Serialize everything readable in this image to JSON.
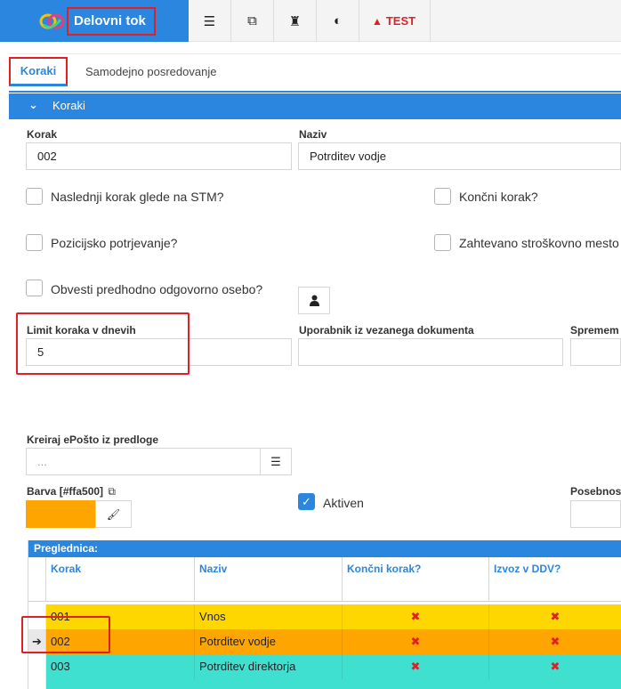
{
  "app": {
    "title": "Delovni tok",
    "test_label": "TEST"
  },
  "toolbar": {
    "icons": [
      "list-indent-icon",
      "external-link-icon",
      "user-secret-icon",
      "contrast-icon"
    ],
    "indent_glyph": "☰",
    "link_glyph": "⧉",
    "secret_glyph": "♜",
    "contrast_glyph": "◐",
    "warn_glyph": "▲"
  },
  "tabs": [
    {
      "label": "Koraki",
      "active": true
    },
    {
      "label": "Samodejno posredovanje",
      "active": false
    }
  ],
  "section": {
    "title": "Koraki",
    "chevron": "⌄"
  },
  "form": {
    "korak_label": "Korak",
    "korak_value": "002",
    "naziv_label": "Naziv",
    "naziv_value": "Potrditev vodje",
    "cb_stm": "Naslednji korak glede na STM?",
    "cb_koncni": "Končni korak?",
    "cb_pozicijsko": "Pozicijsko potrjevanje?",
    "cb_strosko": "Zahtevano stroškovno mesto",
    "cb_obvesti": "Obvesti predhodno odgovorno osebo?",
    "person_glyph": "👤",
    "limit_label": "Limit koraka v dnevih",
    "limit_value": "5",
    "uporabnik_label": "Uporabnik iz vezanega dokumenta",
    "spremem_label": "Spremem",
    "kreiraj_label": "Kreiraj ePošto iz predloge",
    "kreiraj_placeholder": "...",
    "list_glyph": "☰",
    "barva_label": "Barva [#ffa500]",
    "copy_glyph": "⧉",
    "barva_color": "#ffa500",
    "brush_glyph": "🖌",
    "aktiven_label": "Aktiven",
    "aktiven_checked": true,
    "check_glyph": "✓",
    "posebnos_label": "Posebnos"
  },
  "grid": {
    "caption": "Preglednica:",
    "columns": [
      "Korak",
      "Naziv",
      "Končni korak?",
      "Izvoz v DDV?"
    ],
    "current_glyph": "➔",
    "x_glyph": "✖",
    "rows": [
      {
        "korak": "001",
        "naziv": "Vnos",
        "color": "#ffd700"
      },
      {
        "korak": "002",
        "naziv": "Potrditev vodje",
        "color": "#ffa500"
      },
      {
        "korak": "003",
        "naziv": "Potrditev direktorja",
        "color": "#40e0d0"
      }
    ]
  },
  "colors": {
    "accent": "#2a86de",
    "highlight": "#e01f26"
  }
}
